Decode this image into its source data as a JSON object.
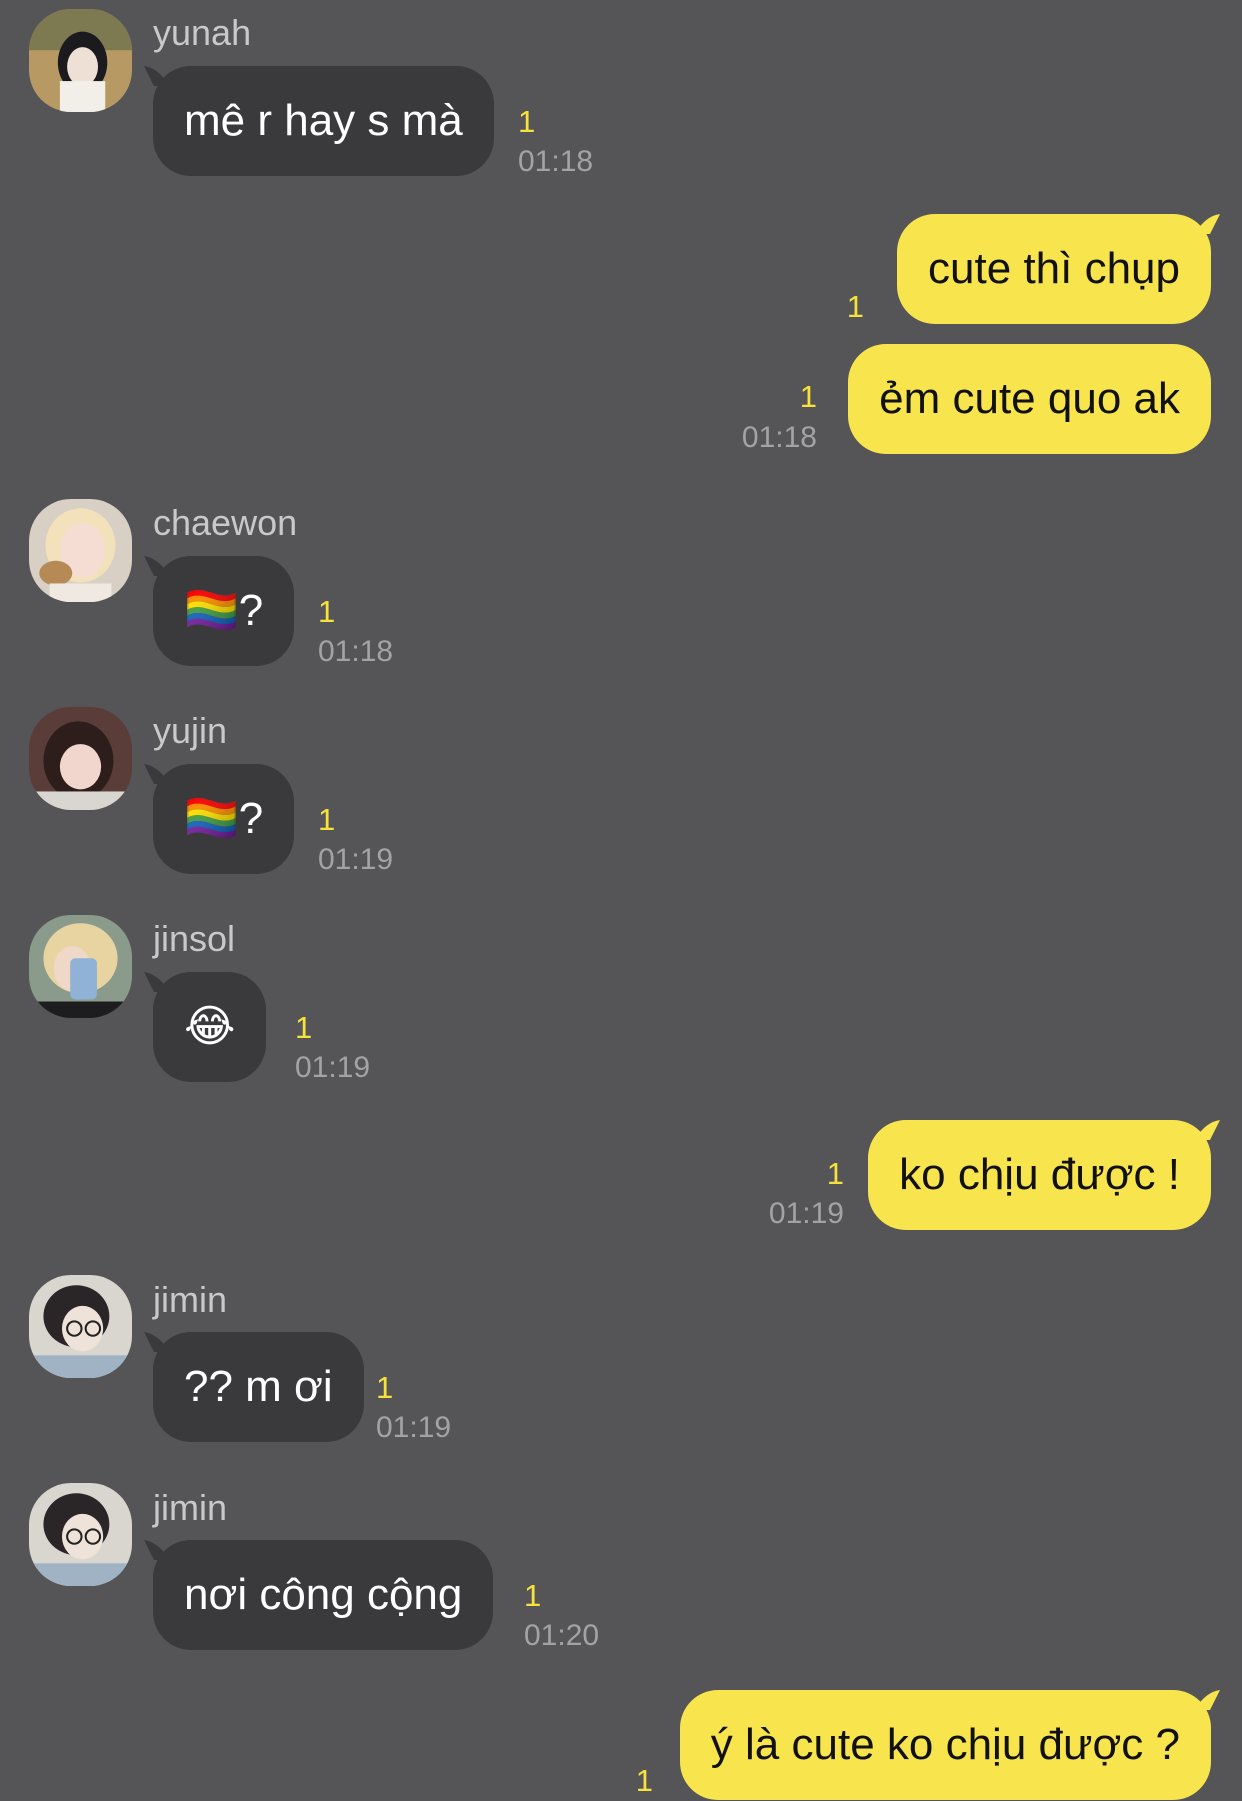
{
  "messages": [
    {
      "sender": "yunah",
      "text": "mê r hay s mà",
      "unread": "1",
      "time": "01:18"
    },
    {
      "text": "cute thì chụp",
      "unread": "1"
    },
    {
      "text": "ẻm cute quo ak",
      "unread": "1",
      "time": "01:18"
    },
    {
      "sender": "chaewon",
      "text": "🏳️‍🌈?",
      "unread": "1",
      "time": "01:18"
    },
    {
      "sender": "yujin",
      "text": "🏳️‍🌈?",
      "unread": "1",
      "time": "01:19"
    },
    {
      "sender": "jinsol",
      "text": "😂",
      "unread": "1",
      "time": "01:19"
    },
    {
      "text": "ko chịu được !",
      "unread": "1",
      "time": "01:19"
    },
    {
      "sender": "jimin",
      "text": "?? m ơi",
      "unread": "1",
      "time": "01:19"
    },
    {
      "sender": "jimin",
      "text": "nơi công cộng",
      "unread": "1",
      "time": "01:20"
    },
    {
      "text": "ý là cute ko chịu được ?",
      "unread": "1"
    }
  ],
  "colors": {
    "background": "#555456",
    "incoming_bubble": "#3a393b",
    "outgoing_bubble": "#f8e44d",
    "unread_count": "#f7e23c",
    "timestamp": "#a3a3a5"
  }
}
